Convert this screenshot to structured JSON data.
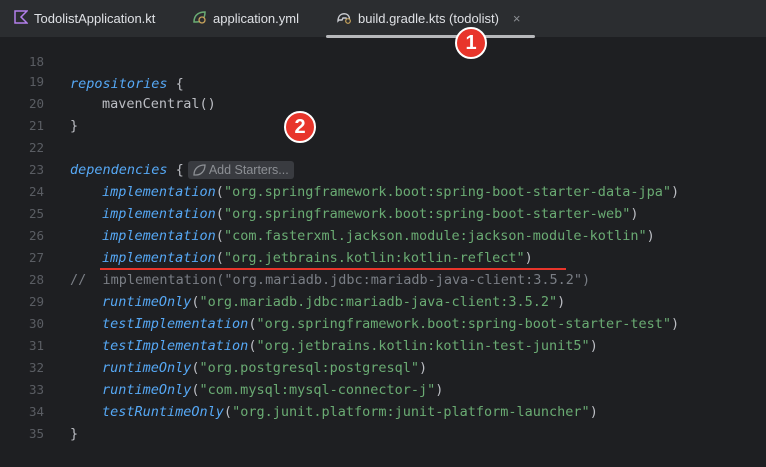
{
  "tabs": [
    {
      "label": "TodolistApplication.kt",
      "icon": "kotlin-file-icon",
      "active": false
    },
    {
      "label": "application.yml",
      "icon": "spring-config-icon",
      "active": false
    },
    {
      "label": "build.gradle.kts (todolist)",
      "icon": "gradle-icon",
      "active": true,
      "close": "×"
    }
  ],
  "badges": {
    "one": "1",
    "two": "2"
  },
  "inlay": {
    "label": "Add Starters...",
    "icon": "spring-leaf-icon"
  },
  "lines": [
    {
      "num": "18",
      "keyword": "repositories",
      "rest": " {"
    },
    {
      "num": "19",
      "fn": "mavenCentral",
      "rest": "()"
    },
    {
      "num": "20",
      "text": "}"
    },
    {
      "num": "21",
      "text": ""
    },
    {
      "num": "22",
      "keyword": "dependencies",
      "rest": " {"
    },
    {
      "num": "23",
      "fn": "implementation",
      "str": "\"org.springframework.boot:spring-boot-starter-data-jpa\""
    },
    {
      "num": "24",
      "fn": "implementation",
      "str": "\"org.springframework.boot:spring-boot-starter-web\""
    },
    {
      "num": "25",
      "fn": "implementation",
      "str": "\"com.fasterxml.jackson.module:jackson-module-kotlin\""
    },
    {
      "num": "26",
      "fn": "implementation",
      "str": "\"org.jetbrains.kotlin:kotlin-reflect\""
    },
    {
      "num": "27",
      "comment": "//  implementation(\"org.mariadb.jdbc:mariadb-java-client:3.5.2\")"
    },
    {
      "num": "28",
      "fn": "runtimeOnly",
      "str": "\"org.mariadb.jdbc:mariadb-java-client:3.5.2\""
    },
    {
      "num": "29",
      "fn": "testImplementation",
      "str": "\"org.springframework.boot:spring-boot-starter-test\""
    },
    {
      "num": "30",
      "fn": "testImplementation",
      "str": "\"org.jetbrains.kotlin:kotlin-test-junit5\""
    },
    {
      "num": "31",
      "fn": "runtimeOnly",
      "str": "\"org.postgresql:postgresql\""
    },
    {
      "num": "32",
      "fn": "runtimeOnly",
      "str": "\"com.mysql:mysql-connector-j\""
    },
    {
      "num": "33",
      "fn": "testRuntimeOnly",
      "str": "\"org.junit.platform:junit-platform-launcher\""
    },
    {
      "num": "34",
      "text": "}"
    },
    {
      "num": "35",
      "text": ""
    }
  ],
  "colors": {
    "badge": "#e8352b",
    "underline": "#e8352b",
    "string": "#6aab73",
    "function": "#56a8f5"
  }
}
